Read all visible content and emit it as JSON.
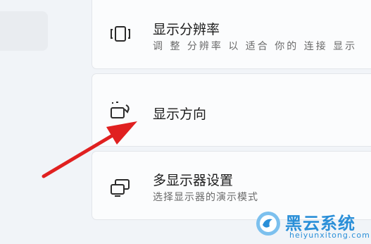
{
  "settings": {
    "items": [
      {
        "icon": "display-resolution-icon",
        "title": "显示分辨率",
        "subtitle": "调 整 分辨率 以 适合 你的 连接 显示"
      },
      {
        "icon": "display-orientation-icon",
        "title": "显示方向",
        "subtitle": ""
      },
      {
        "icon": "multiple-displays-icon",
        "title": "多显示器设置",
        "subtitle": "选择显示器的演示模式"
      }
    ]
  },
  "annotation": {
    "arrow_color": "#e02020"
  },
  "watermark": {
    "name": "黑云系统",
    "url": "heiyunxitong.com",
    "color": "#2a8fd8"
  }
}
